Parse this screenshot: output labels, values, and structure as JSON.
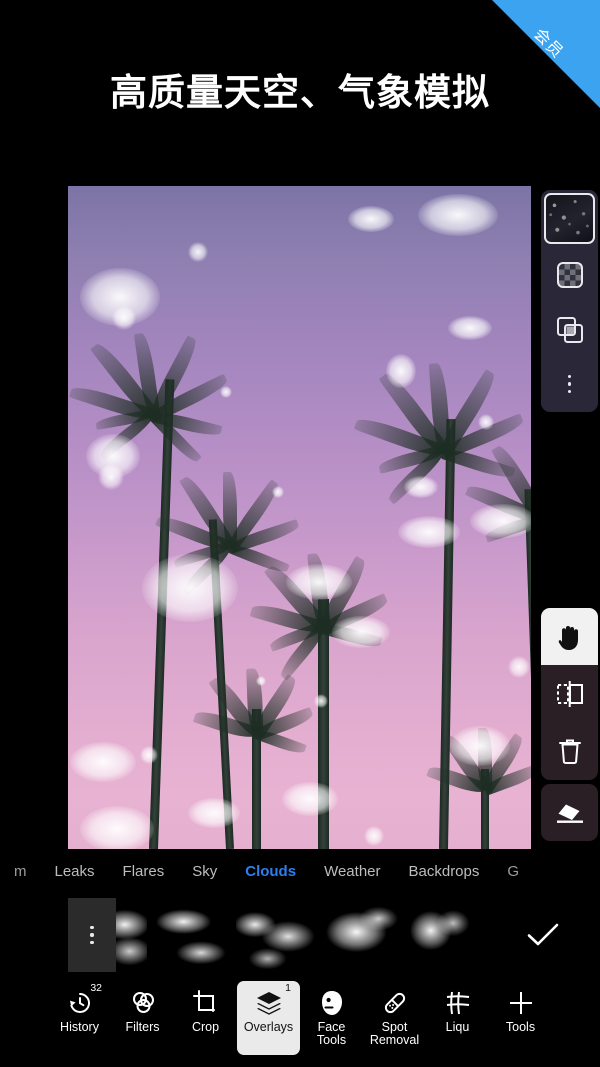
{
  "promo": {
    "headline": "高质量天空、气象模拟",
    "ribbon_label": "会员",
    "ribbon_color": "#3ba3f0"
  },
  "canvas": {
    "description": "purple-to-pink gradient sky with palm tree silhouettes and white cloud overlay",
    "sky_top_color": "#7c74a6",
    "sky_bottom_color": "#e5b0cf"
  },
  "layer_panel": {
    "thumbnail_name": "overlay-layer-thumbnail",
    "buttons": [
      {
        "name": "blend-mode-button",
        "icon": "checkerboard-icon"
      },
      {
        "name": "duplicate-layer-button",
        "icon": "layers-duplicate-icon"
      },
      {
        "name": "layer-more-button",
        "icon": "more-vertical-icon"
      }
    ]
  },
  "tool_panel": {
    "buttons": [
      {
        "name": "pan-tool",
        "icon": "hand-icon",
        "active": true
      },
      {
        "name": "flip-tool",
        "icon": "mirror-flip-icon",
        "active": false
      },
      {
        "name": "delete-tool",
        "icon": "trash-icon",
        "active": false
      }
    ],
    "eraser": {
      "name": "eraser-tool",
      "icon": "eraser-icon"
    }
  },
  "tabs": {
    "active_color": "#2d7ff0",
    "items": [
      {
        "label": "m",
        "active": false,
        "partial": true
      },
      {
        "label": "Leaks",
        "active": false,
        "partial": false
      },
      {
        "label": "Flares",
        "active": false,
        "partial": false
      },
      {
        "label": "Sky",
        "active": false,
        "partial": false
      },
      {
        "label": "Clouds",
        "active": true,
        "partial": false
      },
      {
        "label": "Weather",
        "active": false,
        "partial": false
      },
      {
        "label": "Backdrops",
        "active": false,
        "partial": false
      },
      {
        "label": "G",
        "active": false,
        "partial": true
      }
    ]
  },
  "filmstrip": {
    "menu_icon": "more-vertical-icon",
    "confirm_icon": "checkmark-icon",
    "thumbnails": [
      {
        "name": "cloud-thumbnail-1"
      },
      {
        "name": "cloud-thumbnail-2"
      },
      {
        "name": "cloud-thumbnail-3"
      },
      {
        "name": "cloud-thumbnail-4"
      },
      {
        "name": "cloud-thumbnail-5"
      }
    ]
  },
  "bottom_nav": {
    "items": [
      {
        "label": "History",
        "icon": "history-icon",
        "badge": "32",
        "active": false,
        "truncated": false
      },
      {
        "label": "Filters",
        "icon": "filters-icon",
        "badge": "",
        "active": false,
        "truncated": false
      },
      {
        "label": "Crop",
        "icon": "crop-icon",
        "badge": "",
        "active": false,
        "truncated": false
      },
      {
        "label": "Overlays",
        "icon": "overlays-icon",
        "badge": "1",
        "active": true,
        "truncated": false
      },
      {
        "label": "Face\nTools",
        "icon": "face-tools-icon",
        "badge": "",
        "active": false,
        "truncated": false
      },
      {
        "label": "Spot\nRemoval",
        "icon": "spot-removal-icon",
        "badge": "",
        "active": false,
        "truncated": false
      },
      {
        "label": "Liqu",
        "icon": "liquify-icon",
        "badge": "",
        "active": false,
        "truncated": true
      },
      {
        "label": "Tools",
        "icon": "tools-plus-icon",
        "badge": "",
        "active": false,
        "truncated": false
      }
    ]
  }
}
